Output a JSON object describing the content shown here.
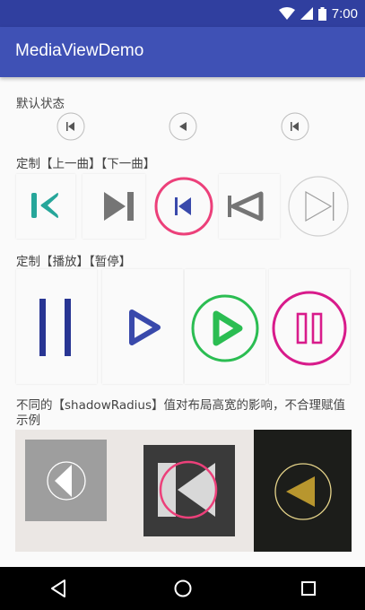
{
  "status_bar": {
    "time": "7:00",
    "icons": [
      "wifi-icon",
      "signal-icon",
      "battery-icon"
    ]
  },
  "app_bar": {
    "title": "MediaViewDemo",
    "color": "#3f51b5"
  },
  "sections": {
    "default": {
      "label": "默认状态",
      "buttons": [
        "prev-icon",
        "play-icon",
        "prev-icon"
      ]
    },
    "custom_prev_next": {
      "label": "定制【上一曲】【下一曲】",
      "buttons": [
        "prev-teal-icon",
        "next-gray-icon",
        "prev-pink-circle-icon",
        "prev-outline-icon",
        "next-outline-circle-icon"
      ]
    },
    "custom_play_pause": {
      "label": "定制【播放】【暂停】",
      "buttons": [
        "pause-indigo-icon",
        "play-indigo-icon",
        "play-green-circle-icon",
        "pause-magenta-circle-icon"
      ]
    },
    "shadow_radius": {
      "label": "不同的【shadowRadius】值对布局高宽的影响，不合理赋值示例",
      "buttons": [
        "play-white-icon",
        "prev-pink-icon",
        "play-gold-icon"
      ]
    }
  },
  "colors": {
    "teal": "#26a69a",
    "pink": "#ec407a",
    "indigo": "#283593",
    "green": "#2bbd52",
    "magenta": "#d81b8b",
    "gold": "#b8962e"
  },
  "nav_bar": {
    "buttons": [
      "back-icon",
      "home-icon",
      "recents-icon"
    ]
  }
}
